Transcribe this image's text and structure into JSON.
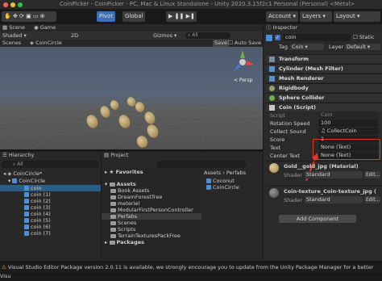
{
  "window": {
    "title": "CoinPicker - CoinPicker - PC, Mac & Linux Standalone - Unity 2020.3.15f2c1 Personal (Personal) <Metal>"
  },
  "toolbar": {
    "pivot": "Pivot",
    "global": "Global",
    "account": "Account",
    "layers": "Layers",
    "layout": "Layout"
  },
  "scene": {
    "tab_scene": "Scene",
    "tab_game": "Game",
    "shading": "Shaded",
    "mode2d": "2D",
    "gizmos": "Gizmos",
    "search_placeholder": "All",
    "breadcrumb_root": "Scenes",
    "breadcrumb_item": "CoinCircle",
    "save": "Save",
    "autosave": "Auto Save",
    "persp": "< Persp"
  },
  "inspector": {
    "tab": "Inspector",
    "name": "coin",
    "static": "Static",
    "tag_label": "Tag",
    "tag_value": "Coin",
    "layer_label": "Layer",
    "layer_value": "Default",
    "components": [
      "Transform",
      "Cylinder (Mesh Filter)",
      "Mesh Renderer",
      "Rigidbody",
      "Sphere Collider",
      "Coin (Script)"
    ],
    "fields": [
      {
        "label": "Script",
        "value": "Coin"
      },
      {
        "label": "Rotation Speed",
        "value": "100"
      },
      {
        "label": "Collect Sound",
        "value": "CollectCoin"
      },
      {
        "label": "Score",
        "value": "1"
      },
      {
        "label": "Text",
        "value": "None (Text)"
      },
      {
        "label": "Center Text",
        "value": "None (Text)"
      }
    ],
    "materials": [
      {
        "name": "Gold__gold_jpg (Material)",
        "shader_label": "Shader",
        "shader_value": "Standard",
        "edit": "Edit..."
      },
      {
        "name": "Coin-texture_Coin-texture_jpg (",
        "shader_label": "Shader",
        "shader_value": "Standard",
        "edit": "Edit..."
      }
    ],
    "add_component": "Add Component"
  },
  "hierarchy": {
    "tab": "Hierarchy",
    "search_placeholder": "All",
    "scene_name": "CoinCircle*",
    "root": "CoinCircle",
    "items": [
      "coin",
      "coin (1)",
      "coin (2)",
      "coin (3)",
      "coin (4)",
      "coin (5)",
      "coin (6)",
      "coin (7)"
    ]
  },
  "project": {
    "tab": "Project",
    "favorites": "Favorites",
    "assets": "Assets",
    "folders": [
      "Book Assets",
      "DreamForestTree",
      "meteriel",
      "ModularFirstPersonController",
      "Perfabs",
      "Scenes",
      "Scripts",
      "TerrainTexturesPackFree"
    ],
    "packages": "Packages",
    "breadcrumb_root": "Assets",
    "breadcrumb_item": "Perfabs",
    "files": [
      "Coconut",
      "CoinCircle"
    ]
  },
  "status": {
    "message": "Visual Studio Editor Package version 2.0.11 is available, we strongly encourage you to update from the Unity Package Manager for a better Visu"
  },
  "colors": {
    "accent": "#3a70b8",
    "highlight_box": "#e0352b",
    "selected_row": "#2c5d87"
  }
}
